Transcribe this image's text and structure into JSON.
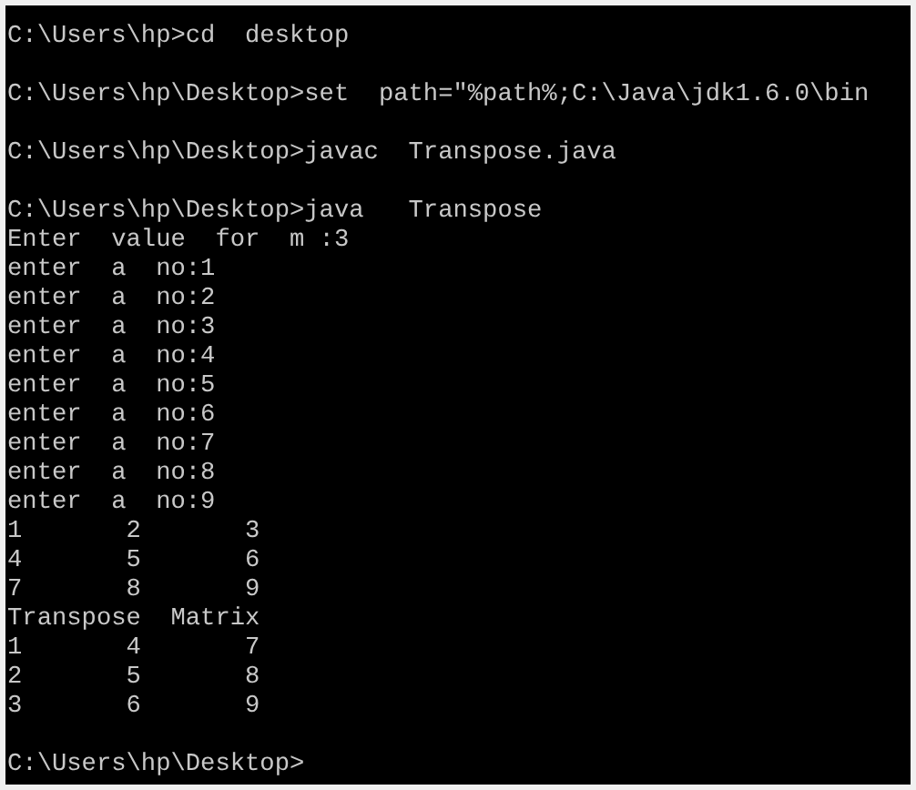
{
  "console_lines": [
    {
      "kind": "text",
      "text": "C:\\Users\\hp>cd  desktop"
    },
    {
      "kind": "blank"
    },
    {
      "kind": "text",
      "text": "C:\\Users\\hp\\Desktop>set  path=\"%path%;C:\\Java\\jdk1.6.0\\bin"
    },
    {
      "kind": "blank"
    },
    {
      "kind": "text",
      "text": "C:\\Users\\hp\\Desktop>javac  Transpose.java"
    },
    {
      "kind": "blank"
    },
    {
      "kind": "text",
      "text": "C:\\Users\\hp\\Desktop>java   Transpose"
    },
    {
      "kind": "text",
      "text": "Enter  value  for  m :3"
    },
    {
      "kind": "text",
      "text": "enter  a  no:1"
    },
    {
      "kind": "text",
      "text": "enter  a  no:2"
    },
    {
      "kind": "text",
      "text": "enter  a  no:3"
    },
    {
      "kind": "text",
      "text": "enter  a  no:4"
    },
    {
      "kind": "text",
      "text": "enter  a  no:5"
    },
    {
      "kind": "text",
      "text": "enter  a  no:6"
    },
    {
      "kind": "text",
      "text": "enter  a  no:7"
    },
    {
      "kind": "text",
      "text": "enter  a  no:8"
    },
    {
      "kind": "text",
      "text": "enter  a  no:9"
    },
    {
      "kind": "row",
      "cells": [
        "1",
        "2",
        "3"
      ]
    },
    {
      "kind": "row",
      "cells": [
        "4",
        "5",
        "6"
      ]
    },
    {
      "kind": "row",
      "cells": [
        "7",
        "8",
        "9"
      ]
    },
    {
      "kind": "text",
      "text": "Transpose  Matrix"
    },
    {
      "kind": "row",
      "cells": [
        "1",
        "4",
        "7"
      ]
    },
    {
      "kind": "row",
      "cells": [
        "2",
        "5",
        "8"
      ]
    },
    {
      "kind": "row",
      "cells": [
        "3",
        "6",
        "9"
      ]
    },
    {
      "kind": "blank"
    },
    {
      "kind": "text",
      "text": "C:\\Users\\hp\\Desktop>"
    }
  ]
}
